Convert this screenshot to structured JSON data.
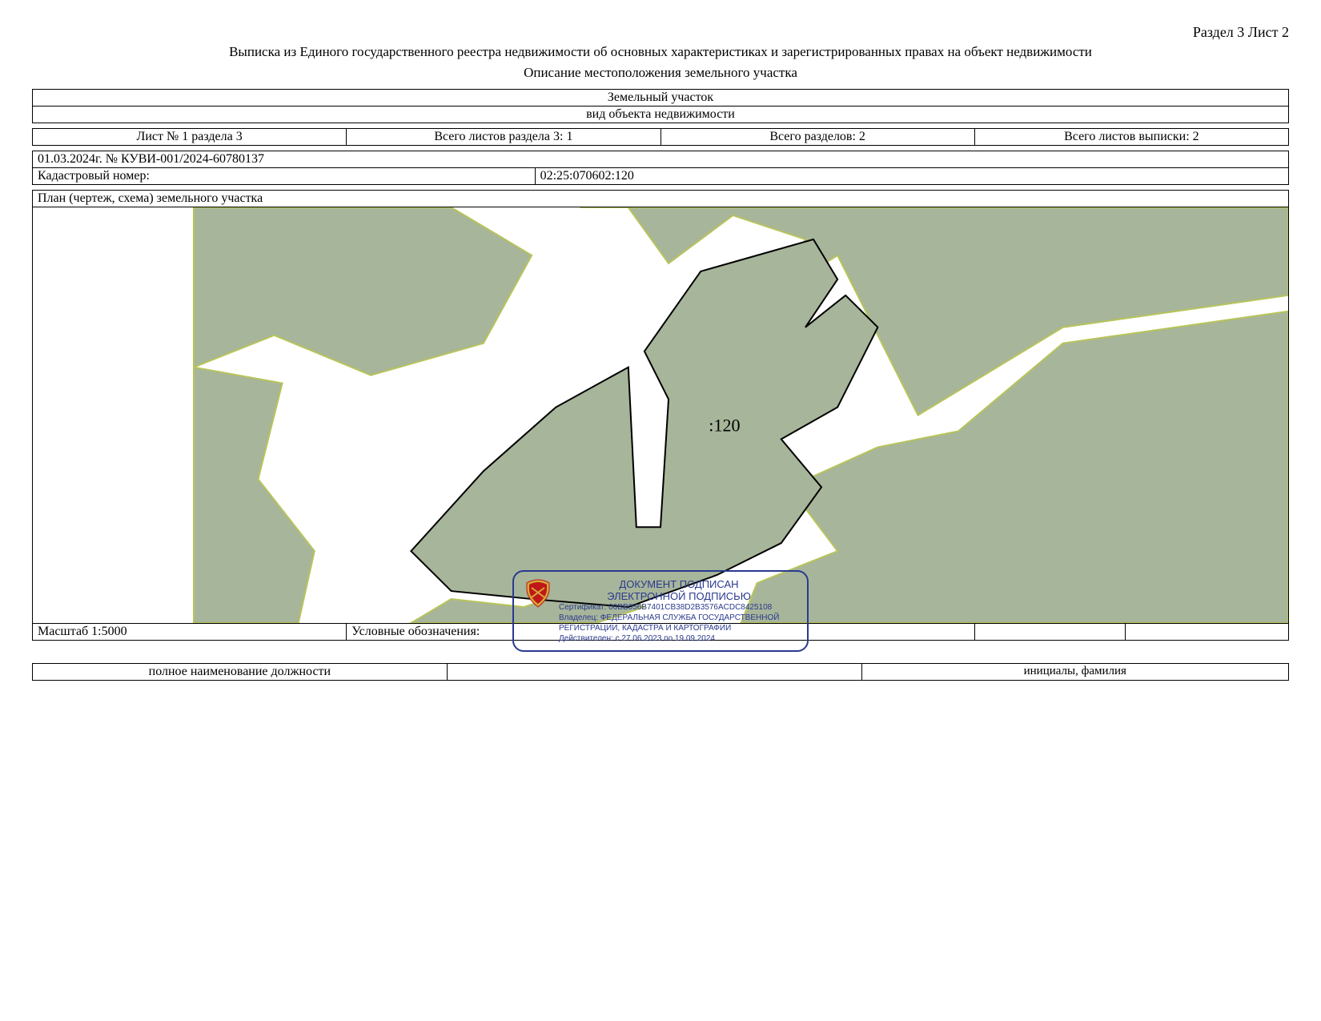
{
  "header": {
    "section_sheet": "Раздел 3   Лист 2",
    "title": "Выписка из Единого государственного реестра недвижимости об основных характеристиках и зарегистрированных правах на объект недвижимости",
    "subtitle": "Описание местоположения земельного участка"
  },
  "object": {
    "name": "Земельный участок",
    "type_label": "вид объекта недвижимости"
  },
  "meta_row": {
    "col1": "Лист № 1 раздела 3",
    "col2": "Всего листов раздела 3: 1",
    "col3": "Всего разделов: 2",
    "col4": "Всего листов выписки: 2"
  },
  "doc_ref": "01.03.2024г. № КУВИ-001/2024-60780137",
  "cadastral": {
    "label": "Кадастровый номер:",
    "value": "02:25:070602:120"
  },
  "plan": {
    "title": "План (чертеж, схема) земельного участка",
    "parcel_label": ":120"
  },
  "scale_row": {
    "scale": "Масштаб 1:5000",
    "legend_label": "Условные обозначения:"
  },
  "footer": {
    "position": "полное наименование должности",
    "initials": "инициалы, фамилия"
  },
  "stamp": {
    "line1": "ДОКУМЕНТ ПОДПИСАН",
    "line2": "ЭЛЕКТРОННОЙ ПОДПИСЬЮ",
    "cert": "Сертификат: 00BB056B7401CB38D2B3576ACDC8425108",
    "owner": "Владелец: ФЕДЕРАЛЬНАЯ СЛУЖБА ГОСУДАРСТВЕННОЙ РЕГИСТРАЦИИ, КАДАСТРА И КАРТОГРАФИИ",
    "valid": "Действителен: с 27.06.2023 по 19.09.2024"
  },
  "colors": {
    "land": "#a7b59a",
    "outline": "#b8c45a",
    "stamp": "#2a3a8f",
    "emblem": "#c01818"
  }
}
